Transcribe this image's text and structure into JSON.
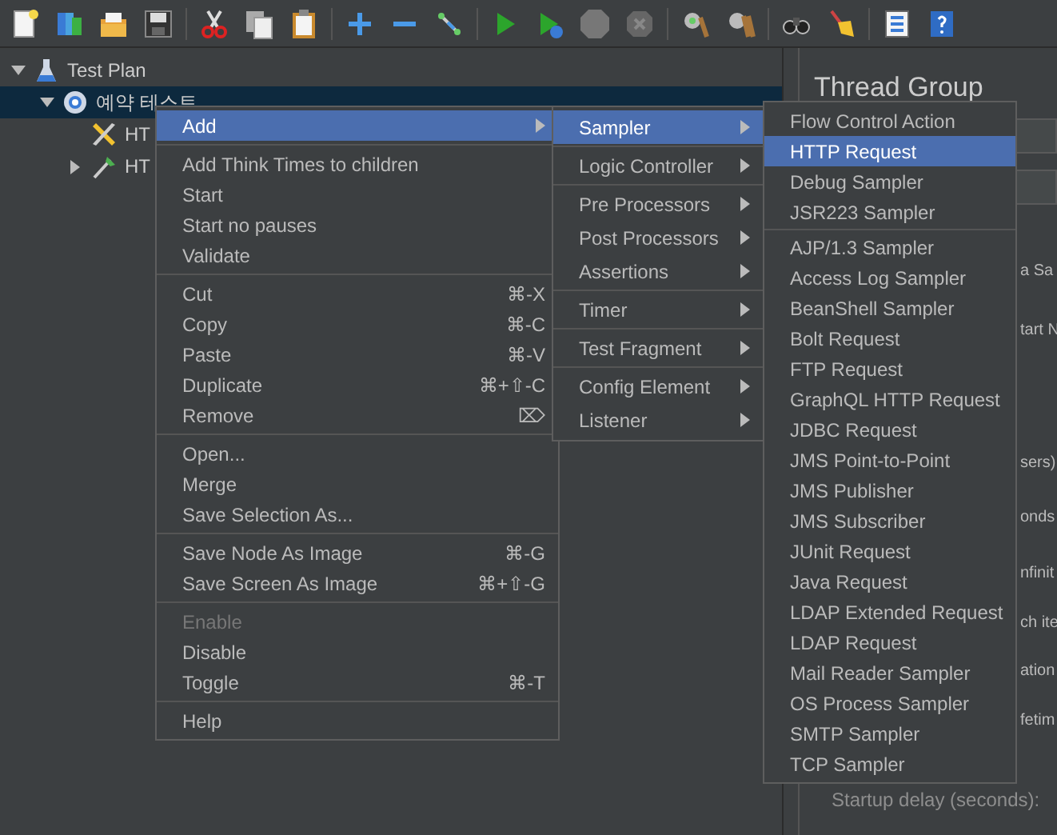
{
  "tree": [
    {
      "label": "Test Plan",
      "kind": "plan",
      "expanded": true,
      "selected": false,
      "children": [
        {
          "label": "예약 테스트",
          "kind": "thread-group",
          "expanded": true,
          "selected": true,
          "children": [
            {
              "label": "HT",
              "kind": "config",
              "selected": false
            },
            {
              "label": "HT",
              "kind": "pre-processor",
              "expanded": false,
              "selected": false
            }
          ]
        }
      ]
    }
  ],
  "panel": {
    "title": "Thread Group",
    "fragments": [
      "a Sa",
      "tart N",
      "sers)",
      "onds",
      "nfinit",
      "ch ite",
      "ation",
      "fetim"
    ],
    "startup_delay_label": "Startup delay (seconds):"
  },
  "context_menu": {
    "groups": [
      [
        {
          "label": "Add",
          "submenu": true,
          "selected": true,
          "disabled": false
        }
      ],
      [
        {
          "label": "Add Think Times to children",
          "submenu": false,
          "selected": false,
          "disabled": false
        },
        {
          "label": "Start",
          "submenu": false,
          "selected": false,
          "disabled": false
        },
        {
          "label": "Start no pauses",
          "submenu": false,
          "selected": false,
          "disabled": false
        },
        {
          "label": "Validate",
          "submenu": false,
          "selected": false,
          "disabled": false
        }
      ],
      [
        {
          "label": "Cut",
          "shortcut": "⌘-X",
          "submenu": false,
          "selected": false,
          "disabled": false
        },
        {
          "label": "Copy",
          "shortcut": "⌘-C",
          "submenu": false,
          "selected": false,
          "disabled": false
        },
        {
          "label": "Paste",
          "shortcut": "⌘-V",
          "submenu": false,
          "selected": false,
          "disabled": false
        },
        {
          "label": "Duplicate",
          "shortcut": "⌘+⇧-C",
          "submenu": false,
          "selected": false,
          "disabled": false
        },
        {
          "label": "Remove",
          "shortcut": "⌦",
          "submenu": false,
          "selected": false,
          "disabled": false
        }
      ],
      [
        {
          "label": "Open...",
          "submenu": false,
          "selected": false,
          "disabled": false
        },
        {
          "label": "Merge",
          "submenu": false,
          "selected": false,
          "disabled": false
        },
        {
          "label": "Save Selection As...",
          "submenu": false,
          "selected": false,
          "disabled": false
        }
      ],
      [
        {
          "label": "Save Node As Image",
          "shortcut": "⌘-G",
          "submenu": false,
          "selected": false,
          "disabled": false
        },
        {
          "label": "Save Screen As Image",
          "shortcut": "⌘+⇧-G",
          "submenu": false,
          "selected": false,
          "disabled": false
        }
      ],
      [
        {
          "label": "Enable",
          "submenu": false,
          "selected": false,
          "disabled": true
        },
        {
          "label": "Disable",
          "submenu": false,
          "selected": false,
          "disabled": false
        },
        {
          "label": "Toggle",
          "shortcut": "⌘-T",
          "submenu": false,
          "selected": false,
          "disabled": false
        }
      ],
      [
        {
          "label": "Help",
          "submenu": false,
          "selected": false,
          "disabled": false
        }
      ]
    ]
  },
  "add_menu": {
    "groups": [
      [
        {
          "label": "Sampler",
          "selected": true
        }
      ],
      [
        {
          "label": "Logic Controller",
          "selected": false
        }
      ],
      [
        {
          "label": "Pre Processors",
          "selected": false
        },
        {
          "label": "Post Processors",
          "selected": false
        },
        {
          "label": "Assertions",
          "selected": false
        }
      ],
      [
        {
          "label": "Timer",
          "selected": false
        }
      ],
      [
        {
          "label": "Test Fragment",
          "selected": false
        }
      ],
      [
        {
          "label": "Config Element",
          "selected": false
        },
        {
          "label": "Listener",
          "selected": false
        }
      ]
    ]
  },
  "sampler_menu": {
    "groups": [
      [
        {
          "label": "Flow Control Action",
          "selected": false
        },
        {
          "label": "HTTP Request",
          "selected": true
        },
        {
          "label": "Debug Sampler",
          "selected": false
        },
        {
          "label": "JSR223 Sampler",
          "selected": false
        }
      ],
      [
        {
          "label": "AJP/1.3 Sampler",
          "selected": false
        },
        {
          "label": "Access Log Sampler",
          "selected": false
        },
        {
          "label": "BeanShell Sampler",
          "selected": false
        },
        {
          "label": "Bolt Request",
          "selected": false
        },
        {
          "label": "FTP Request",
          "selected": false
        },
        {
          "label": "GraphQL HTTP Request",
          "selected": false
        },
        {
          "label": "JDBC Request",
          "selected": false
        },
        {
          "label": "JMS Point-to-Point",
          "selected": false
        },
        {
          "label": "JMS Publisher",
          "selected": false
        },
        {
          "label": "JMS Subscriber",
          "selected": false
        },
        {
          "label": "JUnit Request",
          "selected": false
        },
        {
          "label": "Java Request",
          "selected": false
        },
        {
          "label": "LDAP Extended Request",
          "selected": false
        },
        {
          "label": "LDAP Request",
          "selected": false
        },
        {
          "label": "Mail Reader Sampler",
          "selected": false
        },
        {
          "label": "OS Process Sampler",
          "selected": false
        },
        {
          "label": "SMTP Sampler",
          "selected": false
        },
        {
          "label": "TCP Sampler",
          "selected": false
        }
      ]
    ]
  }
}
